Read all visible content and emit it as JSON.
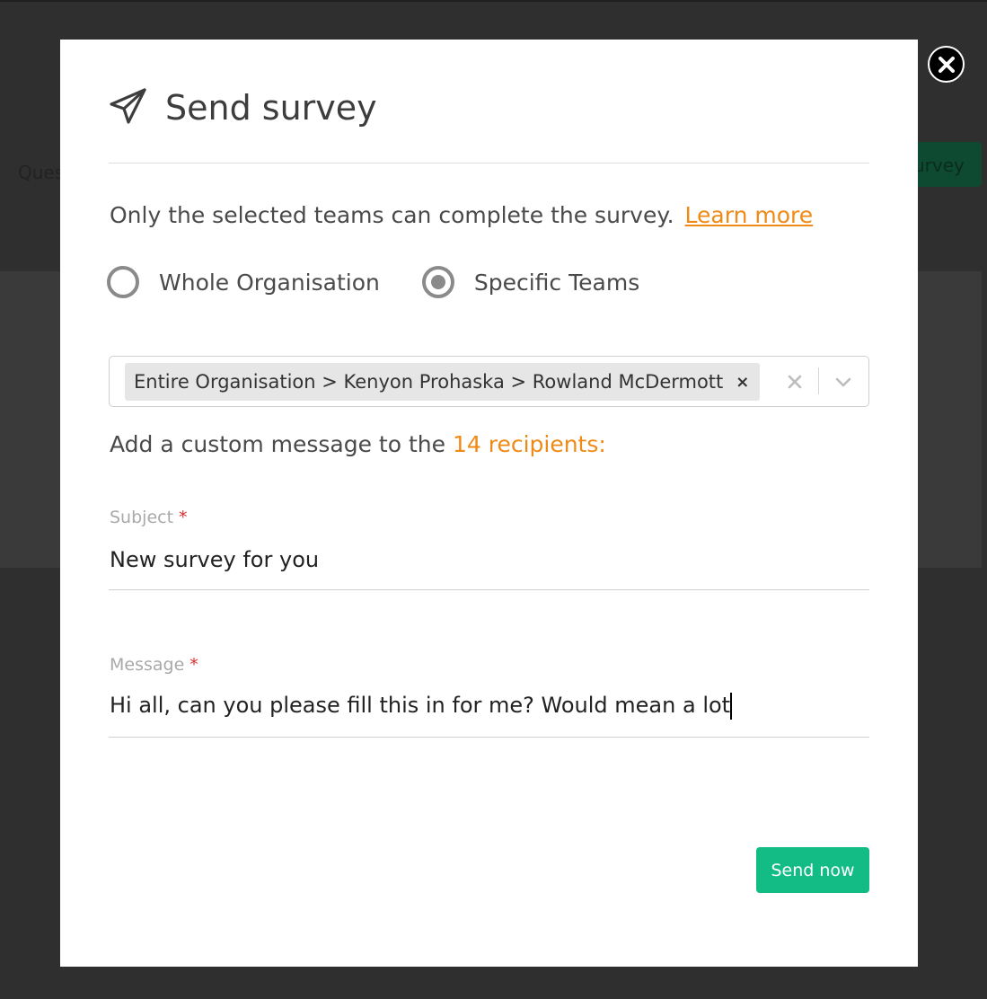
{
  "background": {
    "side_label": "Ques",
    "survey_button_label": "urvey"
  },
  "modal": {
    "title": "Send survey",
    "intro_text": "Only the selected teams can complete the survey.",
    "learn_more_label": "Learn more",
    "audience_options": [
      {
        "label": "Whole Organisation",
        "selected": false
      },
      {
        "label": "Specific Teams",
        "selected": true
      }
    ],
    "team_select": {
      "selected_chip": "Entire Organisation > Kenyon Prohaska > Rowland McDermott",
      "remove_glyph": "×"
    },
    "custom_message_prefix": "Add a custom message to the",
    "recipients_text": "14 recipients:",
    "subject": {
      "label": "Subject",
      "required_mark": "*",
      "value": "New survey for you"
    },
    "message": {
      "label": "Message",
      "required_mark": "*",
      "value": "Hi all, can you please fill this in for me? Would mean a lot"
    },
    "send_button_label": "Send now"
  },
  "colors": {
    "accent_orange": "#ef8a17",
    "primary_green": "#13bb85",
    "required_red": "#d9302c"
  },
  "icons": {
    "close": "close-icon",
    "title": "paper-plane-icon",
    "clear": "clear-x-icon",
    "dropdown": "chevron-down-icon"
  }
}
